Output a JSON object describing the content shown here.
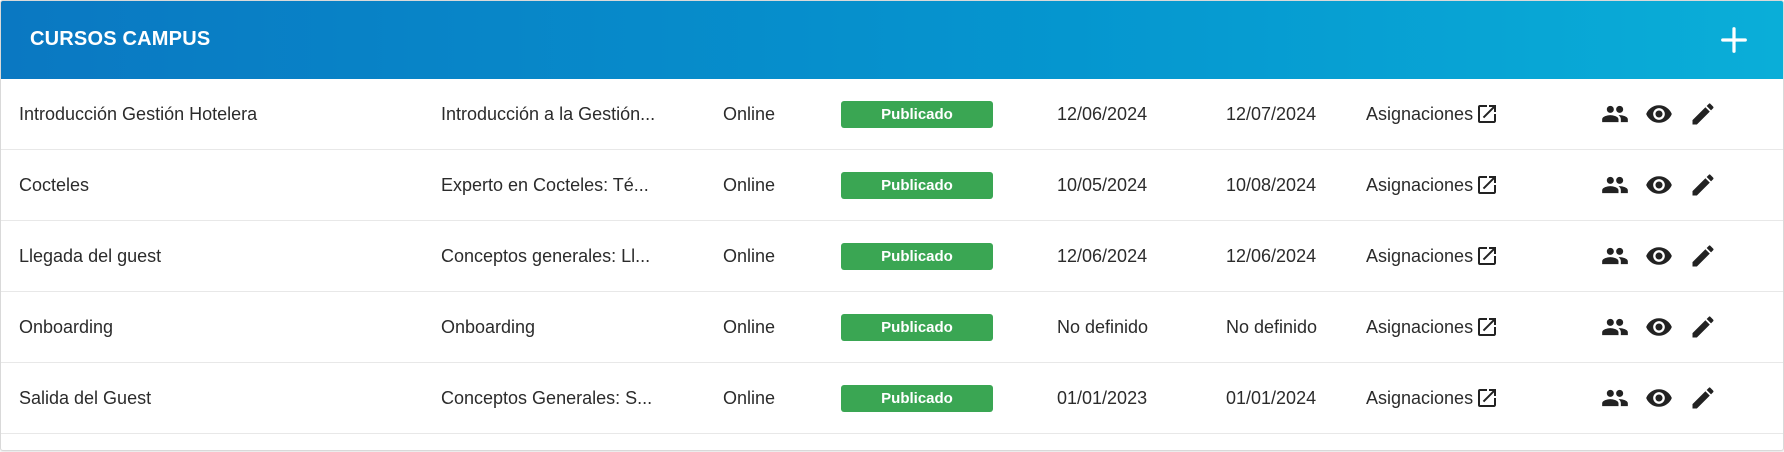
{
  "header": {
    "title": "CURSOS CAMPUS",
    "add_icon": "plus-icon"
  },
  "colors": {
    "header_start": "#0a78c2",
    "header_end": "#0aaed8",
    "badge": "#3aa653"
  },
  "courses": [
    {
      "name": "Introducción Gestión Hotelera",
      "description": "Introducción a la Gestión...",
      "mode": "Online",
      "status": "Publicado",
      "start": "12/06/2024",
      "end": "12/07/2024",
      "assign": "Asignaciones"
    },
    {
      "name": "Cocteles",
      "description": "Experto en Cocteles: Té...",
      "mode": "Online",
      "status": "Publicado",
      "start": "10/05/2024",
      "end": "10/08/2024",
      "assign": "Asignaciones"
    },
    {
      "name": "Llegada del guest",
      "description": "Conceptos generales: Ll...",
      "mode": "Online",
      "status": "Publicado",
      "start": "12/06/2024",
      "end": "12/06/2024",
      "assign": "Asignaciones"
    },
    {
      "name": "Onboarding",
      "description": "Onboarding",
      "mode": "Online",
      "status": "Publicado",
      "start": "No definido",
      "end": "No definido",
      "assign": "Asignaciones"
    },
    {
      "name": "Salida del Guest",
      "description": "Conceptos Generales: S...",
      "mode": "Online",
      "status": "Publicado",
      "start": "01/01/2023",
      "end": "01/01/2024",
      "assign": "Asignaciones"
    }
  ],
  "row_icons": [
    "external-link-icon",
    "group-icon",
    "eye-icon",
    "pencil-icon"
  ]
}
